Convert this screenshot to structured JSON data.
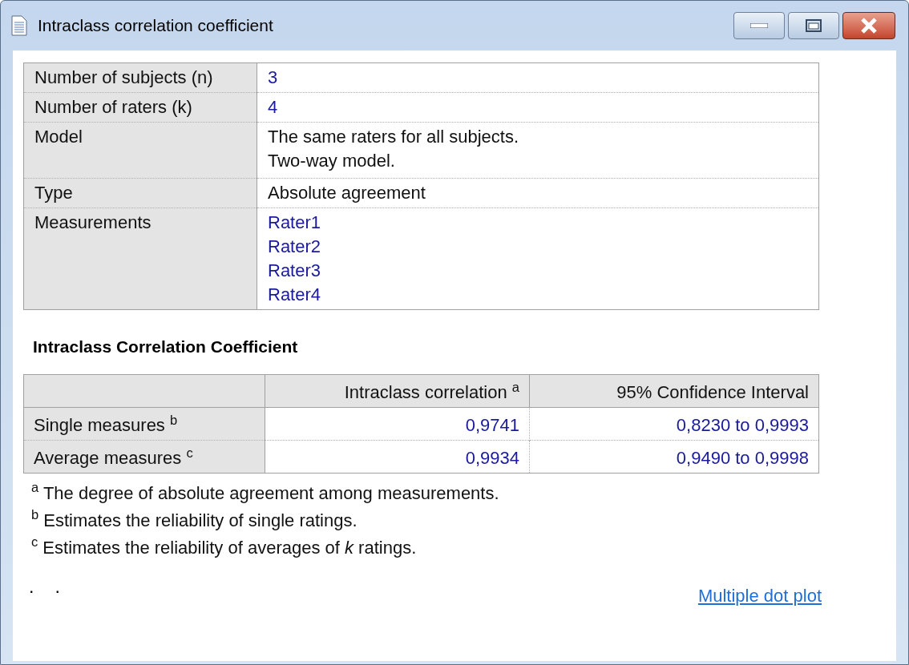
{
  "window": {
    "title": "Intraclass correlation coefficient"
  },
  "info_table": [
    {
      "label": "Number of subjects (n)",
      "values": [
        "3"
      ]
    },
    {
      "label": "Number of raters (k)",
      "values": [
        "4"
      ]
    },
    {
      "label": "Model",
      "values": [
        "The same raters for all subjects.",
        "Two-way model."
      ],
      "kind": "plain"
    },
    {
      "label": "Type",
      "values": [
        "Absolute agreement"
      ],
      "kind": "plain"
    },
    {
      "label": "Measurements",
      "values": [
        "Rater1",
        "Rater2",
        "Rater3",
        "Rater4"
      ]
    }
  ],
  "results": {
    "heading": "Intraclass Correlation Coefficient",
    "value_headers": [
      "Intraclass correlation $^{a}$",
      "95% Confidence Interval"
    ],
    "rows": [
      {
        "label": "Single measures $^{b}$",
        "cells": [
          "0,9741",
          "0,8230 to 0,9993"
        ]
      },
      {
        "label": "Average measures $^{c}$",
        "cells": [
          "0,9934",
          "0,9490 to 0,9998"
        ]
      }
    ]
  },
  "footnotes": [
    "$^{a}$ The degree of absolute agreement among measurements.",
    "$^{b}$ Estimates the reliability of single ratings.",
    "$^{c}$ Estimates the reliability of averages of *k* ratings."
  ],
  "marks": [
    ".",
    "."
  ],
  "link": "Multiple dot plot"
}
